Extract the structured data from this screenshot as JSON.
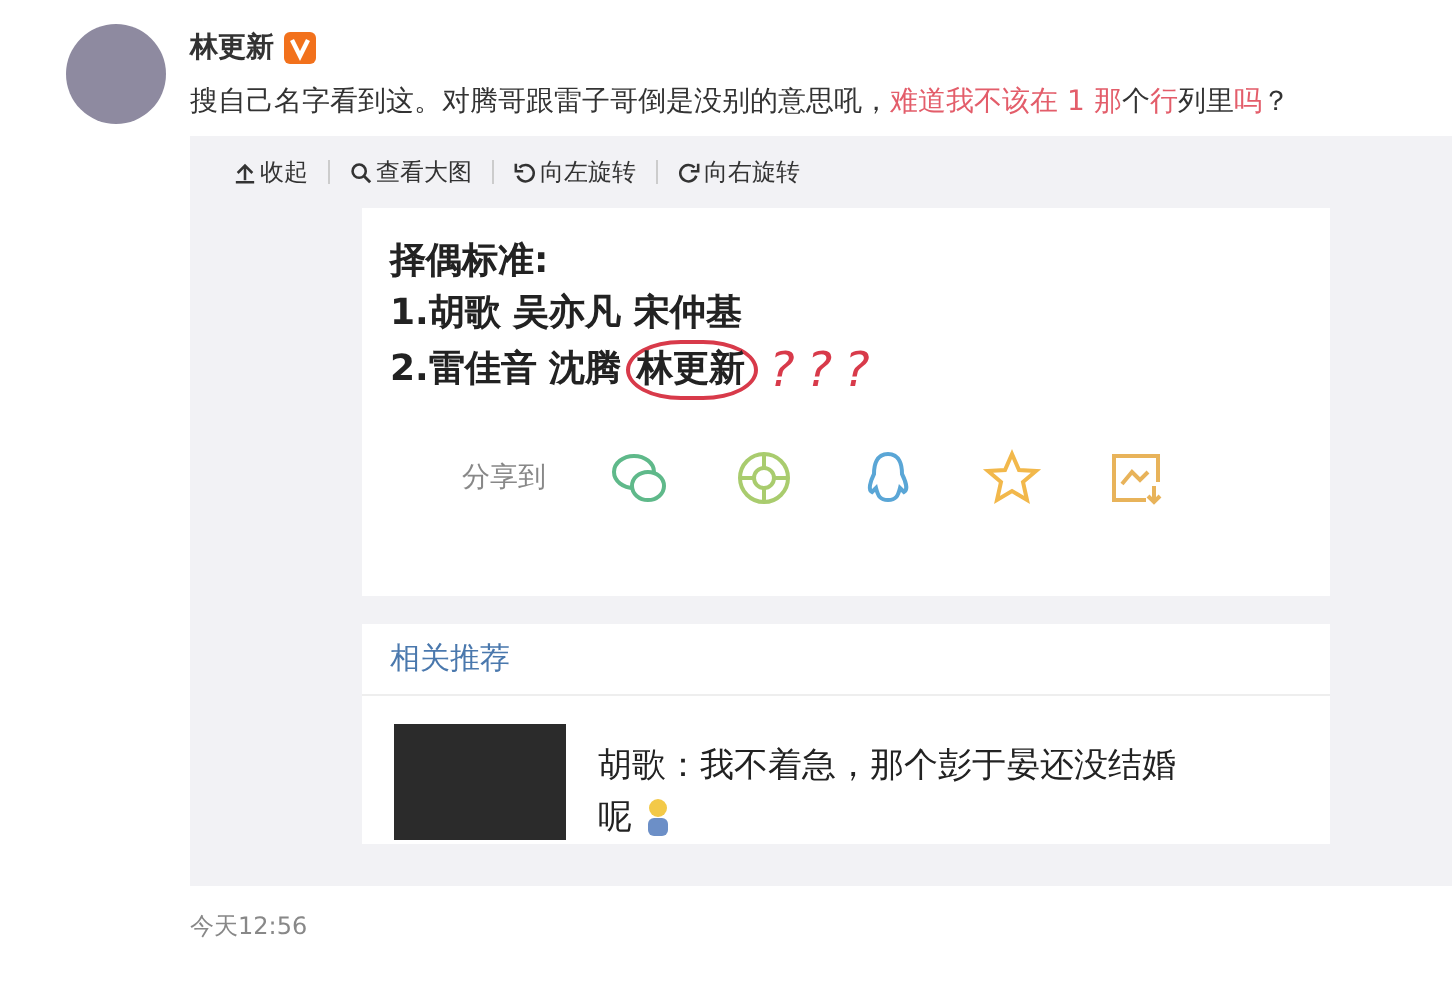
{
  "post": {
    "author": "林更新",
    "verified": true,
    "body": [
      {
        "text": "搜自己名字看到这。对腾哥跟雷子哥倒是没别的意思吼，",
        "highlighted": false
      },
      {
        "text": "难道我不该在 1 那",
        "highlighted": true
      },
      {
        "text": "个",
        "highlighted": false
      },
      {
        "text": "行",
        "highlighted": true
      },
      {
        "text": "列里",
        "highlighted": false
      },
      {
        "text": "吗",
        "highlighted": true
      },
      {
        "text": "？",
        "highlighted": false
      }
    ],
    "toolbar": [
      {
        "kind": "collapse",
        "label": "收起"
      },
      {
        "kind": "zoom",
        "label": "查看大图"
      },
      {
        "kind": "rotate-left",
        "label": "向左旋转"
      },
      {
        "kind": "rotate-right",
        "label": "向右旋转"
      }
    ],
    "image": {
      "heading": "择偶标准:",
      "lines": [
        {
          "text": "1.胡歌 吴亦凡 宋仲基"
        },
        {
          "text": "2.雷佳音 沈腾 ",
          "circled": "林更新"
        }
      ],
      "annotation": "???",
      "share_label": "分享到",
      "share_icons": [
        {
          "kind": "wechat",
          "color": "#5fb98a"
        },
        {
          "kind": "moments",
          "color": "#a9cc6e"
        },
        {
          "kind": "qq",
          "color": "#5aa6d6"
        },
        {
          "kind": "star",
          "color": "#f2b84b"
        },
        {
          "kind": "save",
          "color": "#e8b35a"
        }
      ],
      "related_title": "相关推荐",
      "related_text": [
        "胡歌：我不着急，那个彭于晏还没结婚",
        "呢"
      ]
    },
    "time": "今天12:56"
  }
}
